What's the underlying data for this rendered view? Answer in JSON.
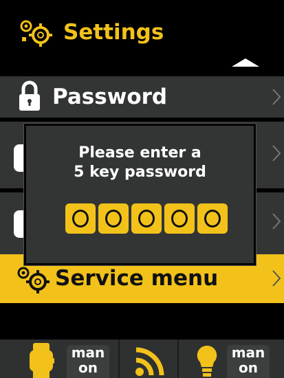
{
  "header": {
    "title": "Settings",
    "icon": "gear-icon"
  },
  "menu": {
    "items": [
      {
        "label": "Password",
        "icon": "lock-icon"
      },
      {
        "label": "",
        "icon": ""
      },
      {
        "label": "",
        "icon": ""
      },
      {
        "label": "Service menu",
        "icon": "gear-icon",
        "selected": true
      }
    ]
  },
  "dialog": {
    "line1": "Please enter a",
    "line2": "5 key password",
    "key_count": 5
  },
  "bottom_bar": {
    "left_badge": {
      "line1": "man",
      "line2": "on"
    },
    "right_badge": {
      "line1": "man",
      "line2": "on"
    },
    "icons": [
      "watch-icon",
      "rss-icon",
      "bulb-icon"
    ]
  },
  "colors": {
    "accent": "#f2c21a",
    "row_bg": "#333535",
    "background": "#000000"
  }
}
